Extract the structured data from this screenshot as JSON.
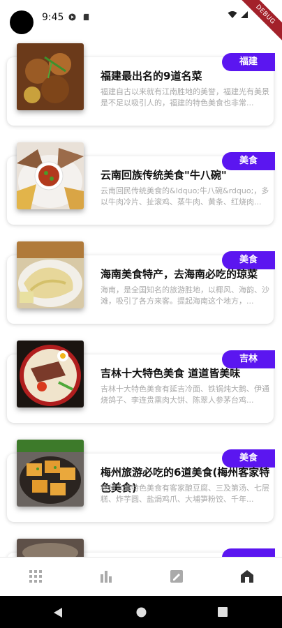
{
  "status": {
    "time": "9:45",
    "debug_label": "DEBUG"
  },
  "colors": {
    "badge": "#5b16f0",
    "debug": "#a3212a"
  },
  "items": [
    {
      "badge": "福建",
      "title": "福建最出名的9道名菜",
      "desc": "福建自古以来就有江南胜地的美誉，福建光有美景是不足以吸引人的，福建的特色美食也非常..."
    },
    {
      "badge": "美食",
      "title": "云南回族传统美食\"牛八碗\"",
      "desc": "云南回民传统美食的&ldquo;牛八碗&rdquo;，多以牛肉冷片、扯滚鸡、蒸牛肉、黄条、红烧肉..."
    },
    {
      "badge": "美食",
      "title": "海南美食特产，去海南必吃的琼菜",
      "desc": "海南，是全国知名的旅游胜地，以椰风、海韵、沙滩，吸引了各方来客。提起海南这个地方，..."
    },
    {
      "badge": "吉林",
      "title": "吉林十大特色美食 道道皆美味",
      "desc": "吉林十大特色美食有延吉冷面、铁锅炖大鹅、伊通烧鸽子、李连贵熏肉大饼、陈翠人参茅台鸡..."
    },
    {
      "badge": "美食",
      "title": "梅州旅游必吃的6道美食(梅州客家特色美食)",
      "desc": "梅州六道特色美食有客家酿豆腐、三及第汤、七层糕、炸芋圆、盐焗鸡爪、大埔笋粉饺、千年..."
    },
    {
      "badge": "",
      "title": "",
      "desc": ""
    }
  ],
  "nav": {
    "icons": [
      "grid-icon",
      "bar-chart-icon",
      "edit-note-icon",
      "home-icon"
    ],
    "active_index": 3
  }
}
